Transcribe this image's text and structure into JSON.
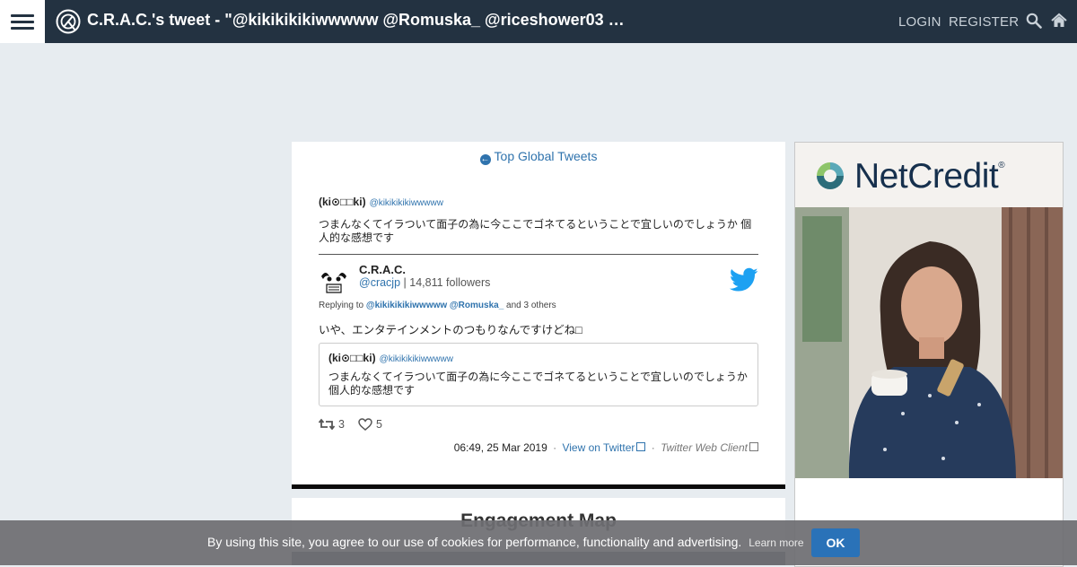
{
  "header": {
    "title": "C.R.A.C.'s tweet - \"@kikikikikiwwwww @Romuska_ @riceshower03 …",
    "login": "LOGIN",
    "register": "REGISTER"
  },
  "card": {
    "back_link": "Top Global Tweets",
    "quoted": {
      "author": "(ki⊙□□ki)",
      "handle": "@kikikikikiwwwww",
      "text": "つまんなくてイラついて面子の為に今ここでゴネてるということで宜しいのでしょうか 個人的な感想です"
    },
    "tweet": {
      "name": "C.R.A.C.",
      "handle": "@cracjp",
      "followers": "| 14,811 followers",
      "reply_prefix": "Replying to",
      "reply_users": "@kikikikikiwwwww @Romuska_",
      "reply_suffix": "and 3 others",
      "text": "いや、エンタテインメントのつもりなんですけどね□",
      "retweets": "3",
      "likes": "5",
      "timestamp": "06:49, 25 Mar 2019",
      "view_link": "View on Twitter",
      "client": "Twitter Web Client"
    },
    "quote_box": {
      "author": "(ki⊙□□ki)",
      "handle": "@kikikikikiwwwww",
      "text": "つまんなくてイラついて面子の為に今ここでゴネてるということで宜しいのでしょうか 個人的な感想です"
    }
  },
  "section2": {
    "title": "Engagement Map"
  },
  "ad": {
    "brand": "NetCredit",
    "brand_mark": "®"
  },
  "cookie": {
    "text": "By using this site, you agree to our use of cookies for performance, functionality and advertising.",
    "learn_more": "Learn more",
    "ok": "OK"
  },
  "colors": {
    "header_bg": "#233241",
    "link": "#2f73ad",
    "twitter_blue": "#1da1f2",
    "ok_button": "#2a72b8"
  },
  "icons": [
    "menu-icon",
    "site-logo-icon",
    "search-icon",
    "home-icon",
    "back-circle-icon",
    "twitter-bird-icon",
    "retweet-icon",
    "heart-icon",
    "external-link-icon"
  ]
}
